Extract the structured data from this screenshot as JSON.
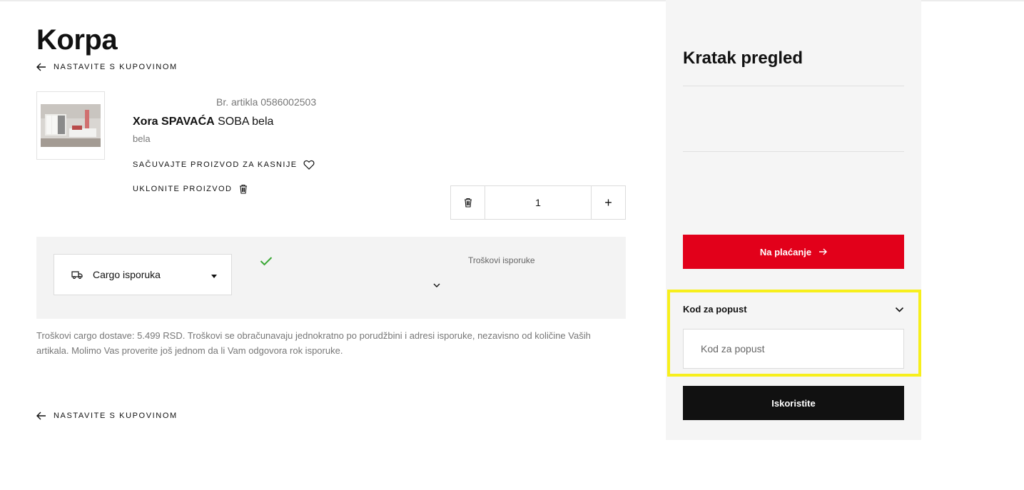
{
  "page": {
    "title": "Korpa"
  },
  "nav": {
    "continue_shopping": "NASTAVITE S KUPOVINOM"
  },
  "cart_item": {
    "article_number": "Br. artikla 0586002503",
    "name_bold": "Xora SPAVAĆA",
    "name_rest": " SOBA bela",
    "variant": "bela",
    "save_label": "SAČUVAJTE PROIZVOD ZA KASNIJE",
    "remove_label": "UKLONITE PROIZVOD",
    "quantity": "1",
    "quantity_plus": "+"
  },
  "delivery": {
    "method": "Cargo isporuka",
    "cost_label": "Troškovi isporuke",
    "note": "Troškovi cargo dostave: 5.499 RSD. Troškovi se obračunavaju jednokratno po porudžbini i adresi isporuke, nezavisno od količine Vaših artikala. Molimo Vas proverite još jednom da li Vam odgovora rok isporuke."
  },
  "summary": {
    "title": "Kratak pregled",
    "checkout_label": "Na plaćanje",
    "discount_label": "Kod za popust",
    "discount_placeholder": "Kod za popust",
    "apply_label": "Iskoristite"
  },
  "colors": {
    "checkout_red": "#e2001a",
    "highlight_yellow": "#f7ef1c",
    "check_green": "#3aa835"
  },
  "icons": [
    "arrow-left-icon",
    "heart-icon",
    "trash-icon",
    "truck-icon",
    "check-icon",
    "chevron-down-icon",
    "arrow-right-icon"
  ]
}
